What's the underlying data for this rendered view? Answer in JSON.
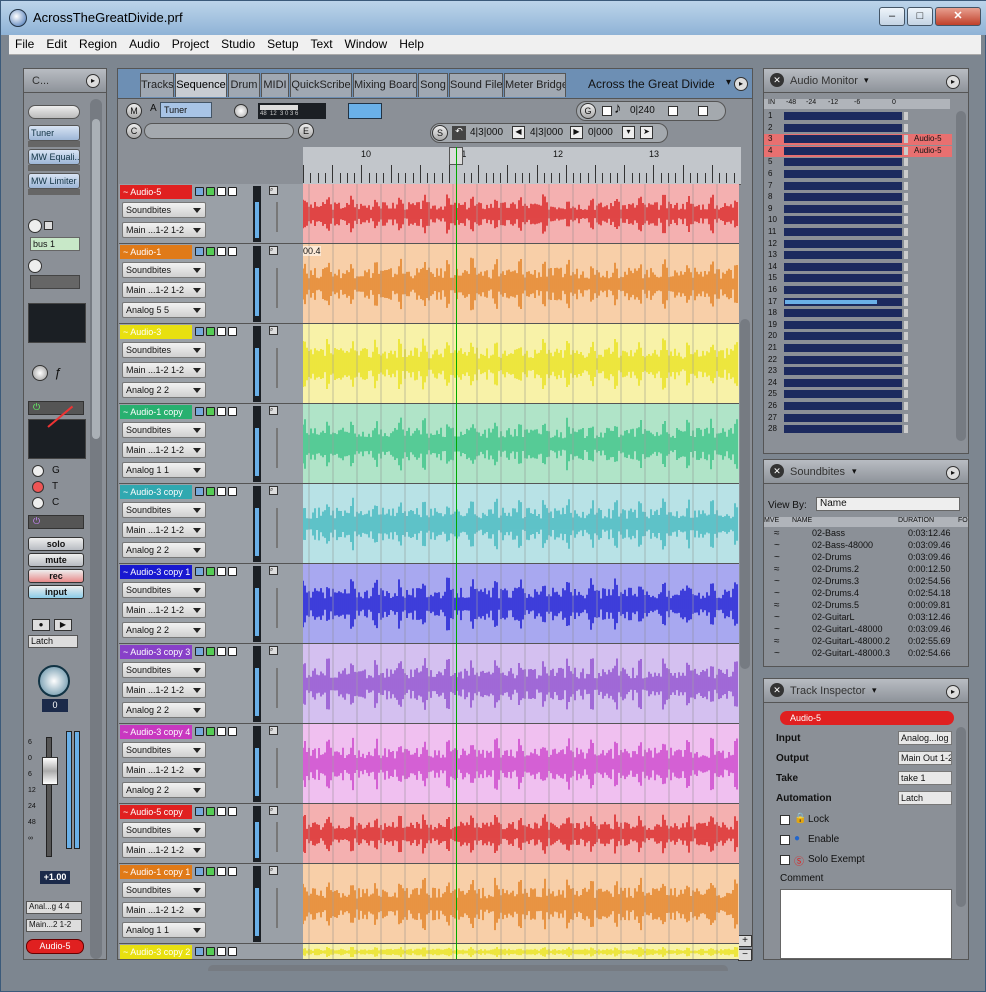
{
  "window": {
    "title": "AcrossTheGreatDivide.prf",
    "min": "‒",
    "max": "□",
    "close": "✕"
  },
  "menu": [
    "File",
    "Edit",
    "Region",
    "Audio",
    "Project",
    "Studio",
    "Setup",
    "Text",
    "Window",
    "Help"
  ],
  "left_strip": {
    "tab": "C...",
    "inserts": [
      "Tuner",
      "MW Equali...",
      "MW Limiter"
    ],
    "bus": "bus 1",
    "knob_letters": [
      "G",
      "T",
      "C"
    ],
    "buttons": {
      "solo": "solo",
      "mute": "mute",
      "rec": "rec",
      "input": "input"
    },
    "latch": "Latch",
    "pan_value": "0",
    "fader_scale": [
      "6",
      "0",
      "6",
      "12",
      "24",
      "48",
      "∞"
    ],
    "gain": "+1.00",
    "input_route": "Anal...g 4 4",
    "output_route": "Main...2 1-2",
    "track_name": "Audio-5"
  },
  "sequence": {
    "tabs": [
      "Tracks",
      "Sequence",
      "Drum",
      "MIDI",
      "QuickScribe",
      "Mixing Board",
      "Song",
      "Sound File",
      "Meter Bridge"
    ],
    "active_tab": "Sequence",
    "sequence_name": "Across the Great Divide",
    "toolbar": {
      "m": "M",
      "a": "A",
      "tuner": "Tuner",
      "c": "C",
      "e": "E",
      "g": "G",
      "s": "S",
      "meter_scale": "48  12  3 0 3 6",
      "tempo": "0|240",
      "loc_start": "4|3|000",
      "loc_end": "4|3|000",
      "loc_len": "0|000"
    },
    "ruler": [
      "10",
      "11",
      "12",
      "13"
    ],
    "tracks": [
      {
        "name": "Audio-5",
        "color": "#e02020",
        "lane": "#f4b0b0",
        "wave": "#d81818",
        "fields": [
          "Soundbites",
          "Main ...1-2 1-2"
        ]
      },
      {
        "name": "Audio-1",
        "color": "#e07a18",
        "lane": "#f8cfa8",
        "wave": "#e07a18",
        "fields": [
          "Soundbites",
          "Main ...1-2 1-2",
          "Analog 5 5"
        ],
        "marker": "00.4"
      },
      {
        "name": "Audio-3",
        "color": "#e8e010",
        "lane": "#f8f2a8",
        "wave": "#e8e010",
        "fields": [
          "Soundbites",
          "Main ...1-2 1-2",
          "Analog 2 2"
        ]
      },
      {
        "name": "Audio-1 copy",
        "color": "#28b070",
        "lane": "#b0e4c8",
        "wave": "#30c080",
        "fields": [
          "Soundbites",
          "Main ...1-2 1-2",
          "Analog 1 1"
        ]
      },
      {
        "name": "Audio-3 copy",
        "color": "#30a8b0",
        "lane": "#b8e2e6",
        "wave": "#38b4bc",
        "fields": [
          "Soundbites",
          "Main ...1-2 1-2",
          "Analog 2 2"
        ]
      },
      {
        "name": "Audio-3 copy 1",
        "color": "#1818d0",
        "lane": "#a8a8f0",
        "wave": "#1010d0",
        "fields": [
          "Soundbites",
          "Main ...1-2 1-2",
          "Analog 2 2"
        ]
      },
      {
        "name": "Audio-3 copy 3",
        "color": "#8840c8",
        "lane": "#d4c0f0",
        "wave": "#8a44cc",
        "fields": [
          "Soundbites",
          "Main ...1-2 1-2",
          "Analog 2 2"
        ]
      },
      {
        "name": "Audio-3 copy 4",
        "color": "#c838c0",
        "lane": "#f0c0f0",
        "wave": "#c838c8",
        "fields": [
          "Soundbites",
          "Main ...1-2 1-2",
          "Analog 2 2"
        ]
      },
      {
        "name": "Audio-5 copy",
        "color": "#e02020",
        "lane": "#f4b0b0",
        "wave": "#d81818",
        "fields": [
          "Soundbites",
          "Main ...1-2 1-2"
        ]
      },
      {
        "name": "Audio-1 copy 1",
        "color": "#e07a18",
        "lane": "#f8cfa8",
        "wave": "#e07a18",
        "fields": [
          "Soundbites",
          "Main ...1-2 1-2",
          "Analog 1 1"
        ]
      },
      {
        "name": "Audio-3 copy 2",
        "color": "#e8e010",
        "lane": "#f8f2a8",
        "wave": "#e8e010",
        "fields": []
      }
    ]
  },
  "audio_monitor": {
    "title": "Audio Monitor",
    "header": [
      "IN",
      "-48",
      "-24",
      "-12",
      "-6",
      "0"
    ],
    "rows": [
      "1",
      "2",
      "3",
      "4",
      "5",
      "6",
      "7",
      "8",
      "9",
      "10",
      "11",
      "12",
      "13",
      "14",
      "15",
      "16",
      "17",
      "18",
      "19",
      "20",
      "21",
      "22",
      "23",
      "24",
      "25",
      "26",
      "27",
      "28"
    ],
    "labels": {
      "3": "Audio-5",
      "4": "Audio-5"
    },
    "active_levels": {
      "17": 0.78
    }
  },
  "soundbites": {
    "title": "Soundbites",
    "view_by_label": "View By:",
    "view_by": "Name",
    "columns": [
      "MVE",
      "NAME",
      "DURATION",
      "FO"
    ],
    "rows": [
      {
        "name": "02-Bass",
        "duration": "0:03:12.46"
      },
      {
        "name": "02-Bass-48000",
        "duration": "0:03:09.46"
      },
      {
        "name": "02-Drums",
        "duration": "0:03:09.46"
      },
      {
        "name": "02-Drums.2",
        "duration": "0:00:12.50"
      },
      {
        "name": "02-Drums.3",
        "duration": "0:02:54.56"
      },
      {
        "name": "02-Drums.4",
        "duration": "0:02:54.18"
      },
      {
        "name": "02-Drums.5",
        "duration": "0:00:09.81"
      },
      {
        "name": "02-GuitarL",
        "duration": "0:03:12.46"
      },
      {
        "name": "02-GuitarL-48000",
        "duration": "0:03:09.46"
      },
      {
        "name": "02-GuitarL-48000.2",
        "duration": "0:02:55.69"
      },
      {
        "name": "02-GuitarL-48000.3",
        "duration": "0:02:54.66"
      }
    ]
  },
  "inspector": {
    "title": "Track Inspector",
    "track": "Audio-5",
    "fields": [
      {
        "label": "Input",
        "value": "Analog...log"
      },
      {
        "label": "Output",
        "value": "Main Out 1-2"
      },
      {
        "label": "Take",
        "value": "take 1"
      },
      {
        "label": "Automation",
        "value": "Latch"
      }
    ],
    "checks": [
      "Lock",
      "Enable",
      "Solo Exempt"
    ],
    "comment_label": "Comment"
  },
  "colors": {
    "accent": "#6a9cc8",
    "record": "#e02020"
  }
}
